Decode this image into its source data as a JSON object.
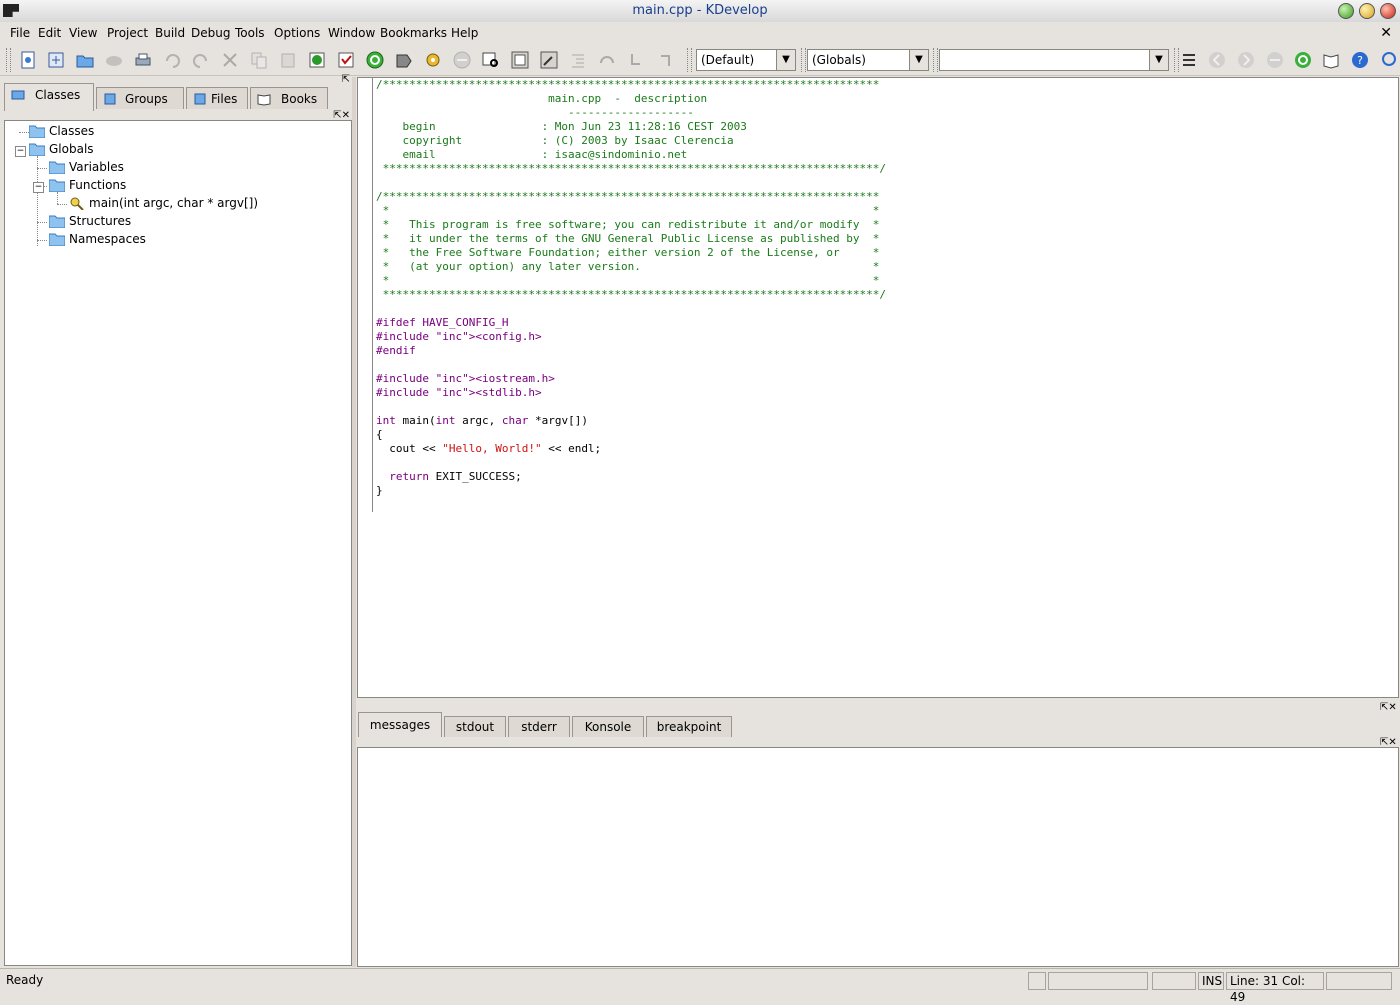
{
  "window": {
    "title": "main.cpp - KDevelop"
  },
  "menu": [
    "File",
    "Edit",
    "View",
    "Project",
    "Build",
    "Debug",
    "Tools",
    "Options",
    "Window",
    "Bookmarks",
    "Help"
  ],
  "toolbar": {
    "icons": [
      "new-file-icon",
      "open-project-icon",
      "open-file-icon",
      "save-icon",
      "print-icon",
      "undo-icon",
      "redo-icon",
      "cut-icon",
      "copy-icon",
      "paste-icon",
      "compile-icon",
      "stop-build-icon",
      "run-icon",
      "build-project-icon",
      "execute-icon",
      "stop-icon",
      "find-in-files-icon",
      "class-view-icon",
      "grep-icon",
      "indent-icon",
      "step-over-icon",
      "step-into-icon",
      "step-out-icon"
    ],
    "config_combo": "(Default)",
    "scope_combo": "(Globals)",
    "function_combo": "",
    "right_icons": [
      "bookmark-icon",
      "back-icon",
      "forward-icon",
      "stop-nav-icon",
      "reload-icon",
      "docs-icon",
      "help-icon",
      "search-icon"
    ]
  },
  "left_tabs": [
    "Classes",
    "Groups",
    "Files",
    "Books"
  ],
  "tree": [
    {
      "label": "Classes"
    },
    {
      "label": "Globals"
    },
    {
      "label": "Variables"
    },
    {
      "label": "Functions"
    },
    {
      "label": "main(int argc, char * argv[])"
    },
    {
      "label": "Structures"
    },
    {
      "label": "Namespaces"
    }
  ],
  "editor": {
    "lines": [
      "/***************************************************************************",
      "                          main.cpp  -  description",
      "                             -------------------",
      "    begin                : Mon Jun 23 11:28:16 CEST 2003",
      "    copyright            : (C) 2003 by Isaac Clerencia",
      "    email                : isaac@sindominio.net",
      " ***************************************************************************/",
      "",
      "/***************************************************************************",
      " *                                                                         *",
      " *   This program is free software; you can redistribute it and/or modify  *",
      " *   it under the terms of the GNU General Public License as published by  *",
      " *   the Free Software Foundation; either version 2 of the License, or     *",
      " *   (at your option) any later version.                                   *",
      " *                                                                         *",
      " ***************************************************************************/",
      "",
      "#ifdef HAVE_CONFIG_H",
      "#include <config.h>",
      "#endif",
      "",
      "#include <iostream.h>",
      "#include <stdlib.h>",
      "",
      "int main(int argc, char *argv[])",
      "{",
      "  cout << \"Hello, World!\" << endl;",
      "",
      "  return EXIT_SUCCESS;",
      "}"
    ]
  },
  "bottom_tabs": [
    "messages",
    "stdout",
    "stderr",
    "Konsole",
    "breakpoint"
  ],
  "status": {
    "text": "Ready",
    "mode": "INS",
    "position": "Line: 31 Col: 49"
  }
}
